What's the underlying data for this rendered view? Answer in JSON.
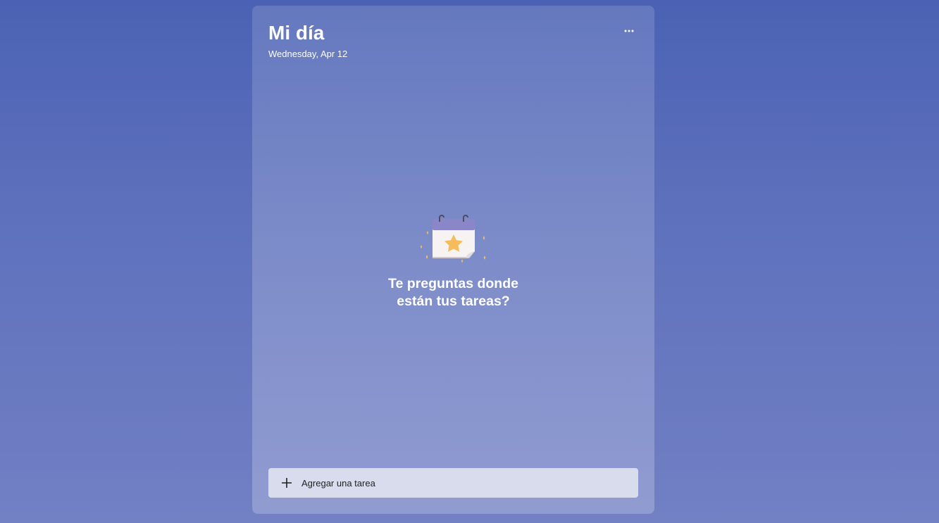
{
  "header": {
    "title": "Mi día",
    "date": "Wednesday, Apr 12",
    "more_icon": "more-horizontal-icon"
  },
  "empty_state": {
    "illustration": "calendar-star-icon",
    "message": "Te preguntas donde están tus tareas?"
  },
  "add_task": {
    "icon": "plus-icon",
    "placeholder": "Agregar una tarea"
  },
  "colors": {
    "background_top": "#4b62b4",
    "background_bottom": "#7280c4",
    "input_background": "#d9dcec",
    "star": "#f6bc5a",
    "calendar_header": "#8a86c8"
  }
}
